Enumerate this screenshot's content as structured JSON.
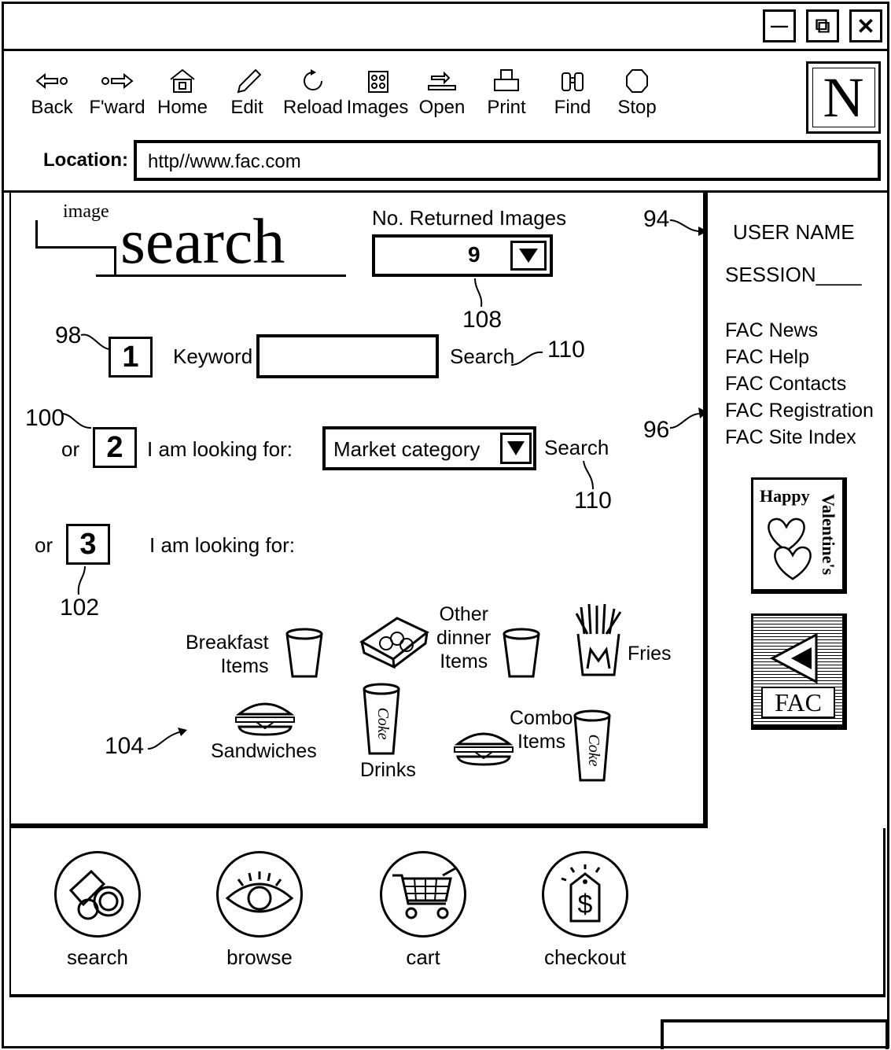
{
  "window": {
    "buttons": {
      "minimize": "—",
      "restore": "⧉",
      "close": "✕"
    }
  },
  "toolbar": {
    "back": "Back",
    "forward": "F'ward",
    "home": "Home",
    "edit": "Edit",
    "reload": "Reload",
    "images": "Images",
    "open": "Open",
    "print": "Print",
    "find": "Find",
    "stop": "Stop",
    "logo_letter": "N"
  },
  "location": {
    "label": "Location:",
    "url": "http//www.fac.com"
  },
  "search_panel": {
    "logo_small": "image",
    "logo_big": "search",
    "returned_label": "No. Returned Images",
    "returned_value": "9",
    "ref_108": "108",
    "ref_98": "98",
    "step1": "1",
    "keyword_label": "Keyword",
    "keyword_value": "",
    "search1": "Search",
    "ref_110a": "110",
    "ref_100": "100",
    "or2": "or",
    "step2": "2",
    "looking_label2": "I am looking for:",
    "category_value": "Market category",
    "search2": "Search",
    "ref_110b": "110",
    "or3": "or",
    "step3": "3",
    "looking_label3": "I am looking for:",
    "ref_102": "102",
    "ref_104": "104",
    "categories": {
      "breakfast_l1": "Breakfast",
      "breakfast_l2": "Items",
      "other_l1": "Other",
      "other_l2": "dinner",
      "other_l3": "Items",
      "fries": "Fries",
      "sandwiches": "Sandwiches",
      "drinks": "Drinks",
      "combo_l1": "Combo",
      "combo_l2": "Items",
      "coke": "Coke"
    }
  },
  "sidebar": {
    "ref_94": "94",
    "ref_96": "96",
    "user_name": "USER NAME",
    "session": "SESSION____",
    "links": [
      "FAC  News",
      "FAC  Help",
      "FAC  Contacts",
      "FAC  Registration",
      "FAC  Site  Index"
    ],
    "valentine_l1": "Happy",
    "valentine_l2": "Valentine's",
    "fac_badge": "FAC"
  },
  "nav": {
    "search": "search",
    "browse": "browse",
    "cart": "cart",
    "checkout": "checkout"
  }
}
